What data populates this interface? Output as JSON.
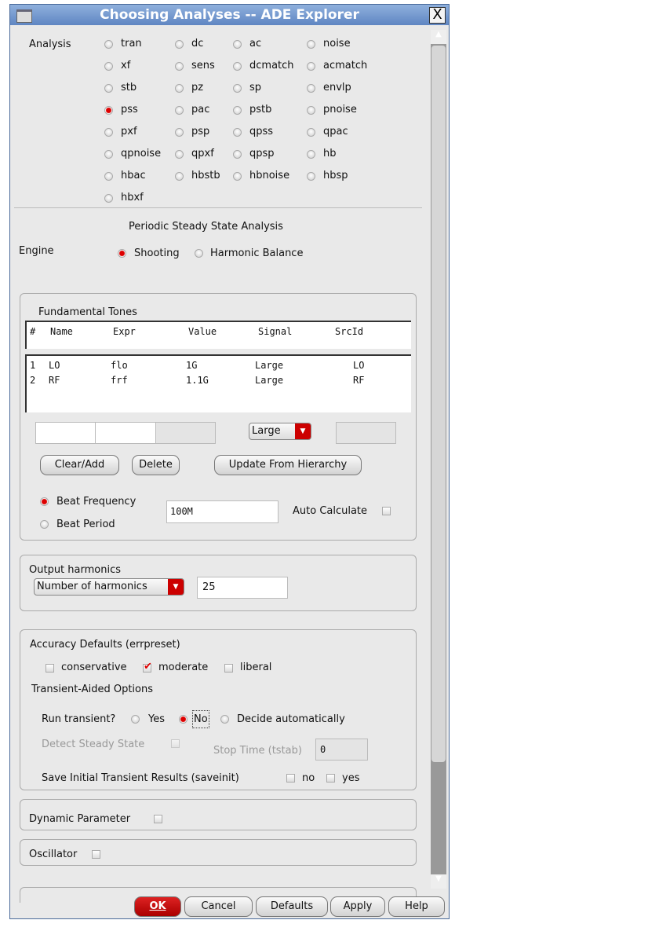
{
  "window": {
    "title": "Choosing Analyses -- ADE Explorer",
    "close": "X"
  },
  "analysis": {
    "label": "Analysis",
    "selected": "pss",
    "options": [
      [
        "tran",
        "dc",
        "ac",
        "noise"
      ],
      [
        "xf",
        "sens",
        "dcmatch",
        "acmatch"
      ],
      [
        "stb",
        "pz",
        "sp",
        "envlp"
      ],
      [
        "pss",
        "pac",
        "pstb",
        "pnoise"
      ],
      [
        "pxf",
        "psp",
        "qpss",
        "qpac"
      ],
      [
        "qpnoise",
        "qpxf",
        "qpsp",
        "hb"
      ],
      [
        "hbac",
        "hbstb",
        "hbnoise",
        "hbsp"
      ],
      [
        "hbxf"
      ]
    ]
  },
  "pss": {
    "heading": "Periodic Steady State Analysis",
    "engine_label": "Engine",
    "engine_options": [
      "Shooting",
      "Harmonic Balance"
    ],
    "engine_selected": "Shooting"
  },
  "tones": {
    "title": "Fundamental Tones",
    "headers": [
      "#",
      "Name",
      "Expr",
      "Value",
      "Signal",
      "SrcId"
    ],
    "rows": [
      [
        "1",
        "LO",
        "flo",
        "1G",
        "Large",
        "LO"
      ],
      [
        "2",
        "RF",
        "frf",
        "1.1G",
        "Large",
        "RF"
      ]
    ],
    "signal_select": "Large",
    "buttons": {
      "clear_add": "Clear/Add",
      "delete": "Delete",
      "update": "Update From Hierarchy"
    },
    "beat_frequency": "Beat Frequency",
    "beat_period": "Beat Period",
    "beat_value": "100M",
    "auto_calculate": "Auto Calculate"
  },
  "harmonics": {
    "title": "Output harmonics",
    "select": "Number of harmonics",
    "value": "25"
  },
  "accuracy": {
    "title": "Accuracy Defaults (errpreset)",
    "options": [
      "conservative",
      "moderate",
      "liberal"
    ],
    "checked": "moderate",
    "transient_title": "Transient-Aided Options",
    "run_transient": "Run transient?",
    "run_options": [
      "Yes",
      "No",
      "Decide automatically"
    ],
    "run_selected": "No",
    "detect": "Detect Steady State",
    "stop_time": "Stop Time (tstab)",
    "stop_value": "0",
    "saveinit": "Save Initial Transient Results (saveinit)",
    "saveinit_options": [
      "no",
      "yes"
    ]
  },
  "dynamic": "Dynamic Parameter",
  "oscillator": "Oscillator",
  "footer": {
    "ok": "OK",
    "cancel": "Cancel",
    "defaults": "Defaults",
    "apply": "Apply",
    "help": "Help"
  }
}
